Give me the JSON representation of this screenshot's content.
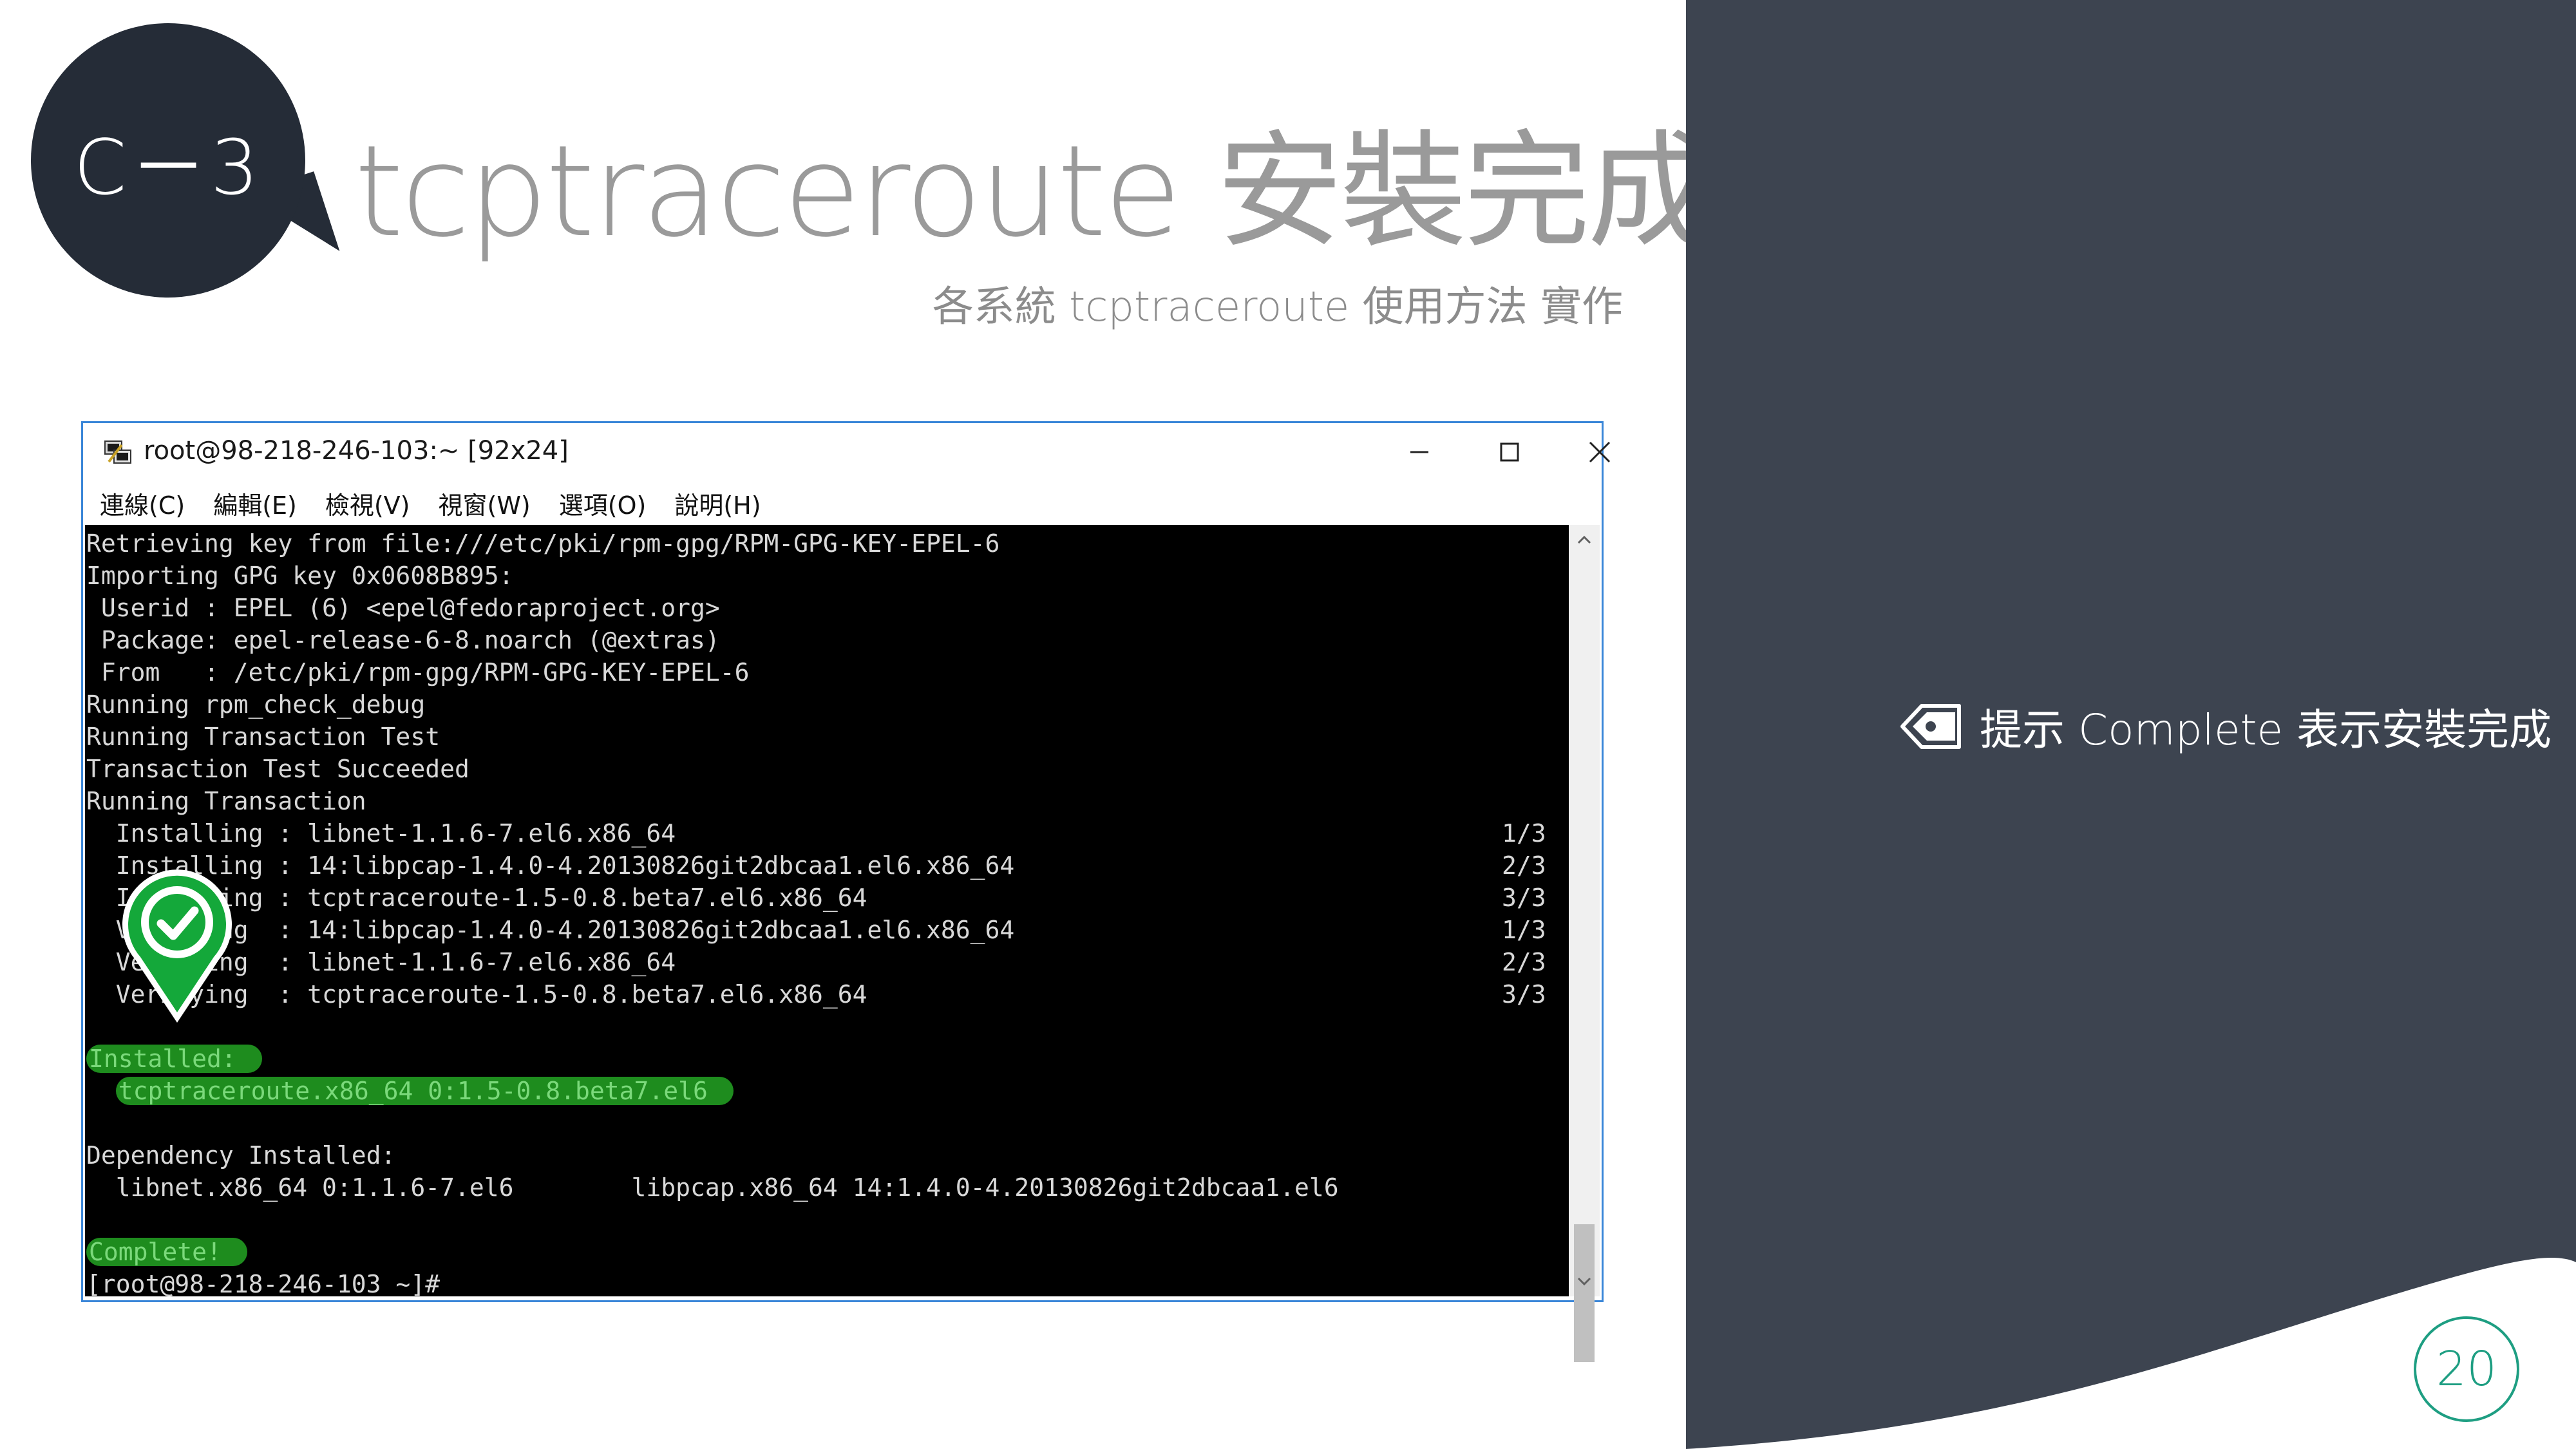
{
  "slide": {
    "badge": "C－3",
    "title": "tcptraceroute 安裝完成",
    "subtitle": "各系統 tcptraceroute 使用方法 實作",
    "page_number": "20",
    "tip_icon": "tag-icon",
    "tip": "提示 Complete 表示安裝完成"
  },
  "window": {
    "title": "root@98-218-246-103:~ [92x24]",
    "app_icon": "putty-icon",
    "controls": [
      "minimize-icon",
      "maximize-icon",
      "close-icon"
    ],
    "menu": [
      "連線(C)",
      "編輯(E)",
      "檢視(V)",
      "視窗(W)",
      "選項(O)",
      "說明(H)"
    ]
  },
  "console": {
    "lines": [
      {
        "text": "Retrieving key from file:///etc/pki/rpm-gpg/RPM-GPG-KEY-EPEL-6"
      },
      {
        "text": "Importing GPG key 0x0608B895:"
      },
      {
        "text": " Userid : EPEL (6) <epel@fedoraproject.org>"
      },
      {
        "text": " Package: epel-release-6-8.noarch (@extras)"
      },
      {
        "text": " From   : /etc/pki/rpm-gpg/RPM-GPG-KEY-EPEL-6"
      },
      {
        "text": "Running rpm_check_debug"
      },
      {
        "text": "Running Transaction Test"
      },
      {
        "text": "Transaction Test Succeeded"
      },
      {
        "text": "Running Transaction"
      },
      {
        "text": "  Installing : libnet-1.1.6-7.el6.x86_64",
        "count": "1/3"
      },
      {
        "text": "  Installing : 14:libpcap-1.4.0-4.20130826git2dbcaa1.el6.x86_64",
        "count": "2/3"
      },
      {
        "text": "  Installing : tcptraceroute-1.5-0.8.beta7.el6.x86_64",
        "count": "3/3"
      },
      {
        "text": "  Verifying  : 14:libpcap-1.4.0-4.20130826git2dbcaa1.el6.x86_64",
        "count": "1/3"
      },
      {
        "text": "  Verifying  : libnet-1.1.6-7.el6.x86_64",
        "count": "2/3"
      },
      {
        "text": "  Verifying  : tcptraceroute-1.5-0.8.beta7.el6.x86_64",
        "count": "3/3"
      },
      {
        "text": ""
      },
      {
        "text": "Installed:",
        "highlight": true
      },
      {
        "prefix": "  ",
        "text": "tcptraceroute.x86_64 0:1.5-0.8.beta7.el6",
        "highlight": true
      },
      {
        "text": ""
      },
      {
        "text": "Dependency Installed:"
      },
      {
        "text": "  libnet.x86_64 0:1.1.6-7.el6        libpcap.x86_64 14:1.4.0-4.20130826git2dbcaa1.el6"
      },
      {
        "text": ""
      },
      {
        "text": "Complete!",
        "highlight": true
      },
      {
        "text": "[root@98-218-246-103 ~]#"
      }
    ],
    "scroll_up_icon": "chevron-up-icon",
    "scroll_down_icon": "chevron-down-icon"
  },
  "marker_icon": "check-location-icon",
  "colors": {
    "dark": "#252c37",
    "panel": "#3d4450",
    "accent": "#1e9e82",
    "highlight": "#1e8c1e",
    "window_border": "#3a86d8"
  }
}
